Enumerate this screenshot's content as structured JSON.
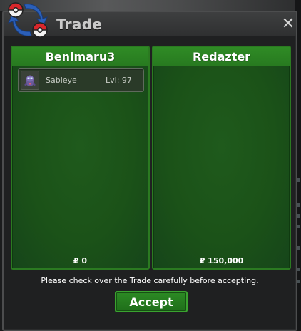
{
  "window": {
    "title": "Trade",
    "close_symbol": "✕",
    "logo_icon": "pokeball-trade-arrows-icon"
  },
  "left_panel": {
    "player": "Benimaru3",
    "items": [
      {
        "icon": "sableye-sprite-icon",
        "name": "Sableye",
        "level": "Lvl: 97"
      }
    ],
    "money": "₽ 0"
  },
  "right_panel": {
    "player": "Redazter",
    "items": [],
    "money": "₽ 150,000"
  },
  "footer": {
    "notice": "Please check over the Trade carefully before accepting.",
    "accept_label": "Accept"
  },
  "colors": {
    "panel_green": "#1b5218",
    "panel_header": "#2f8b25",
    "accept_green": "#2c8a24",
    "window_bg": "#1f2021"
  }
}
